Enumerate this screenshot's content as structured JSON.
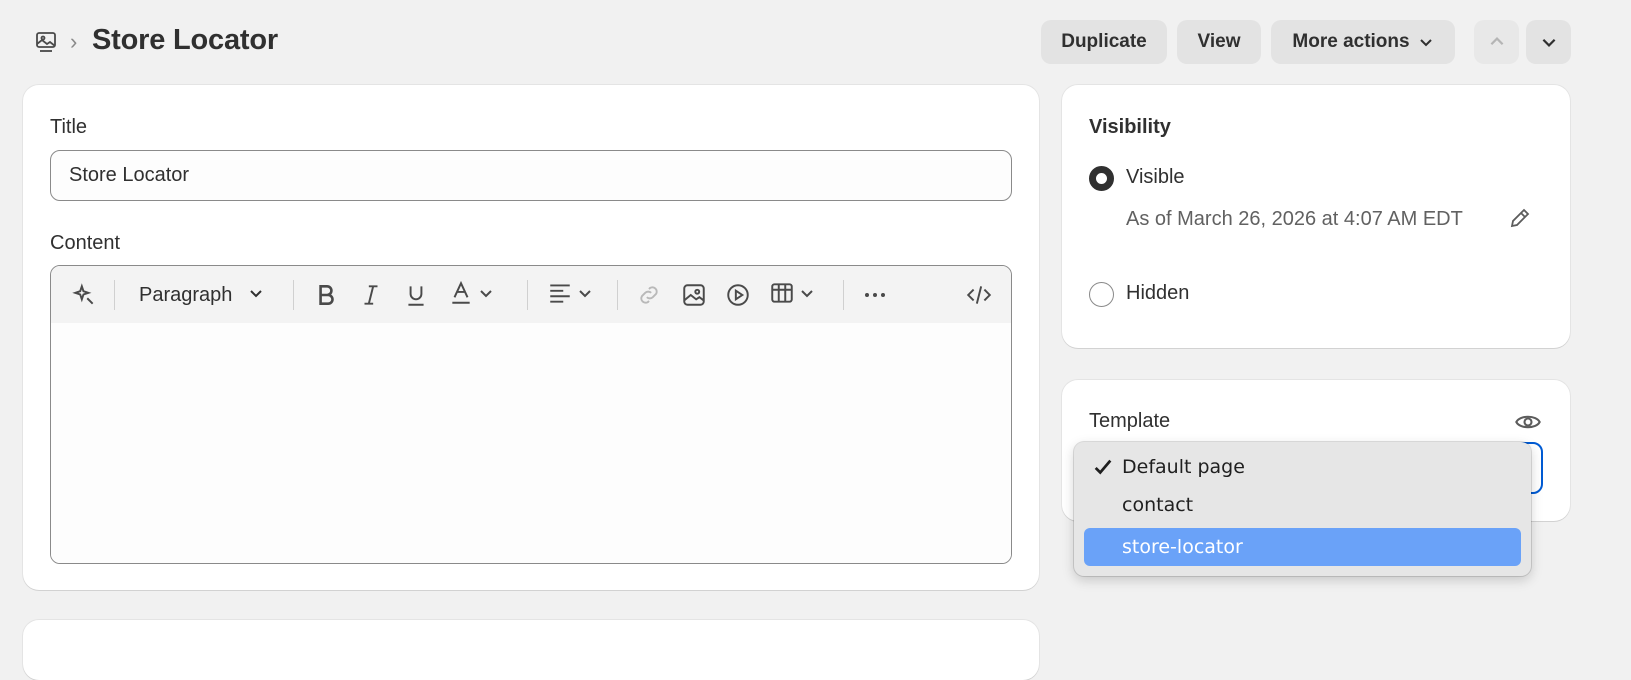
{
  "header": {
    "page_title": "Store Locator",
    "breadcrumb_separator": "›",
    "duplicate_label": "Duplicate",
    "view_label": "View",
    "more_actions_label": "More actions"
  },
  "main": {
    "title_label": "Title",
    "title_value": "Store Locator",
    "content_label": "Content",
    "toolbar": {
      "paragraph_label": "Paragraph"
    }
  },
  "visibility": {
    "heading": "Visibility",
    "options": [
      {
        "label": "Visible",
        "selected": true
      },
      {
        "label": "Hidden",
        "selected": false
      }
    ],
    "visible_since": "As of March 26, 2026 at 4:07 AM EDT"
  },
  "template": {
    "heading": "Template",
    "options": [
      {
        "label": "Default page",
        "checked": true,
        "highlighted": false
      },
      {
        "label": "contact",
        "checked": false,
        "highlighted": false
      },
      {
        "label": "store-locator",
        "checked": false,
        "highlighted": true
      }
    ]
  },
  "colors": {
    "background": "#f1f1f1",
    "focus_border": "#005bd3",
    "highlight": "#6aa2f8"
  }
}
